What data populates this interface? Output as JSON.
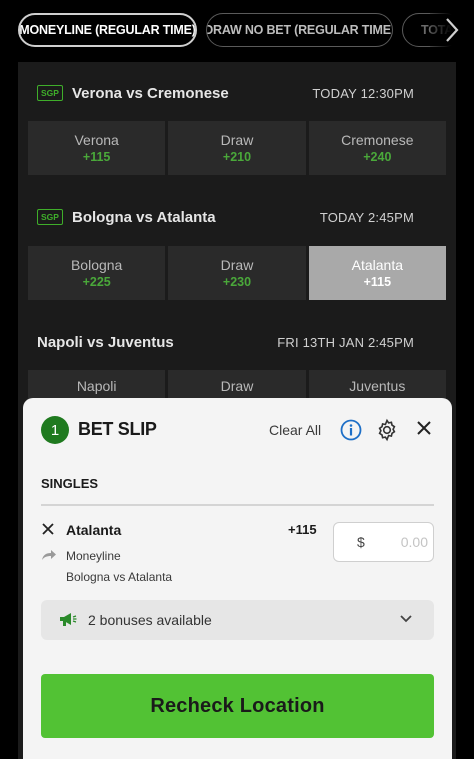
{
  "tabs": [
    {
      "label": "MONEYLINE (REGULAR TIME)",
      "active": true
    },
    {
      "label": "DRAW NO BET (REGULAR TIME)",
      "active": false
    },
    {
      "label": "TOTA",
      "active": false
    }
  ],
  "events": [
    {
      "sgp": "SGP",
      "name": "Verona vs Cremonese",
      "time": "TODAY 12:30PM",
      "odds": [
        {
          "label": "Verona",
          "value": "+115"
        },
        {
          "label": "Draw",
          "value": "+210"
        },
        {
          "label": "Cremonese",
          "value": "+240"
        }
      ]
    },
    {
      "sgp": "SGP",
      "name": "Bologna vs Atalanta",
      "time": "TODAY 2:45PM",
      "odds": [
        {
          "label": "Bologna",
          "value": "+225"
        },
        {
          "label": "Draw",
          "value": "+230"
        },
        {
          "label": "Atalanta",
          "value": "+115"
        }
      ]
    },
    {
      "name": "Napoli vs Juventus",
      "time": "FRI 13TH JAN 2:45PM",
      "odds": [
        {
          "label": "Napoli"
        },
        {
          "label": "Draw"
        },
        {
          "label": "Juventus"
        }
      ]
    }
  ],
  "betslip": {
    "count": "1",
    "title": "BET SLIP",
    "clear_all": "Clear All",
    "section": "SINGLES",
    "selection": {
      "name": "Atalanta",
      "odds": "+115",
      "market": "Moneyline",
      "match": "Bologna vs Atalanta",
      "currency": "$",
      "stake_placeholder": "0.00"
    },
    "bonus_text": "2 bonuses available",
    "cta": "Recheck Location"
  },
  "colors": {
    "accent_green": "#52c234",
    "odds_green": "#4aa83a",
    "badge_green": "#1f7a1f",
    "info_blue": "#1e6fc7"
  }
}
